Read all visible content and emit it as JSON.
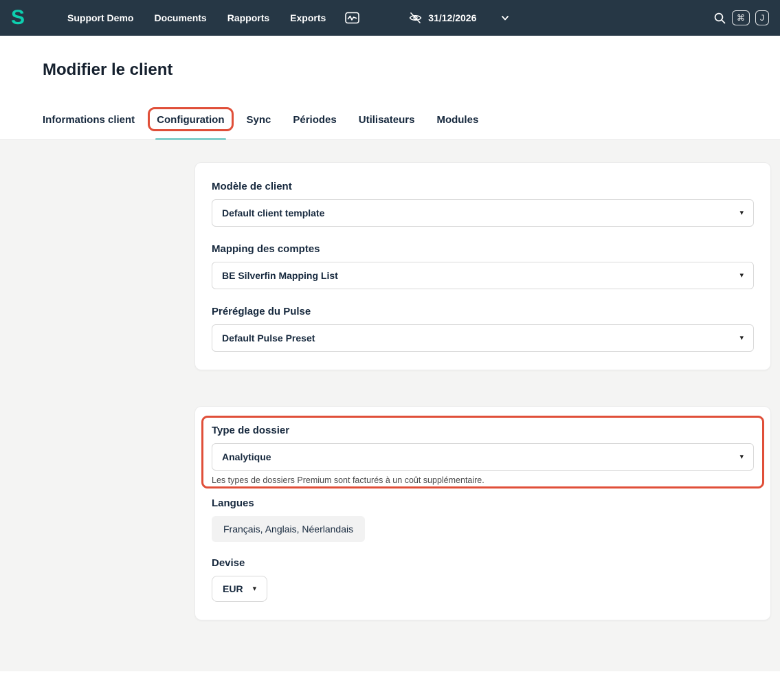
{
  "topbar": {
    "logo_letter": "S",
    "nav_items": [
      "Support Demo",
      "Documents",
      "Rapports",
      "Exports"
    ],
    "date": "31/12/2026",
    "shortcuts": [
      "⌘",
      "J"
    ]
  },
  "page": {
    "title": "Modifier le client"
  },
  "tabs": [
    "Informations client",
    "Configuration",
    "Sync",
    "Périodes",
    "Utilisateurs",
    "Modules"
  ],
  "config_card": {
    "fields": [
      {
        "label": "Modèle de client",
        "value": "Default client template"
      },
      {
        "label": "Mapping des comptes",
        "value": "BE Silverfin Mapping List"
      },
      {
        "label": "Préréglage du Pulse",
        "value": "Default Pulse Preset"
      }
    ]
  },
  "dossier_card": {
    "type_label": "Type de dossier",
    "type_value": "Analytique",
    "type_help": "Les types de dossiers Premium sont facturés à un coût supplémentaire.",
    "langues_label": "Langues",
    "langues_value": "Français, Anglais, Néerlandais",
    "devise_label": "Devise",
    "devise_value": "EUR"
  },
  "icons": {
    "caret": "▾"
  },
  "colors": {
    "topbar_bg": "#263745",
    "brand_teal": "#0dcfb0",
    "annotation_red": "#e04f39",
    "active_tab_underline": "#82cfcb"
  }
}
